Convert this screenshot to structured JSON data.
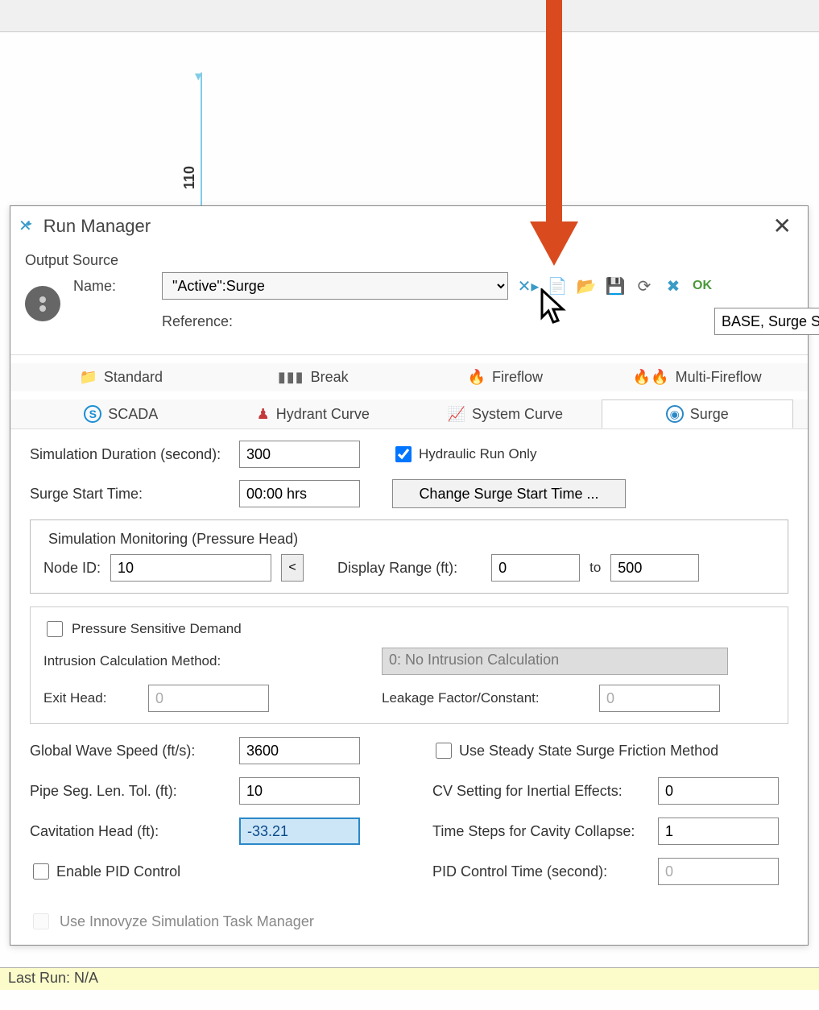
{
  "canvas": {
    "vertical_label": "110"
  },
  "dialog": {
    "title": "Run Manager",
    "output_source": {
      "section_label": "Output Source",
      "name_label": "Name:",
      "name_value": "\"Active\":Surge",
      "reference_label": "Reference:",
      "reference_value": "BASE, Surge Simulation",
      "ok_label": "OK"
    },
    "tabs": {
      "standard": "Standard",
      "break": "Break",
      "fireflow": "Fireflow",
      "multi_fireflow": "Multi-Fireflow",
      "scada": "SCADA",
      "hydrant_curve": "Hydrant Curve",
      "system_curve": "System Curve",
      "surge": "Surge"
    },
    "surge_panel": {
      "sim_duration_label": "Simulation Duration (second):",
      "sim_duration_value": "300",
      "hydraulic_run_only_label": "Hydraulic Run Only",
      "hydraulic_run_only_checked": true,
      "surge_start_time_label": "Surge Start Time:",
      "surge_start_time_value": "00:00 hrs",
      "change_surge_start_button": "Change Surge Start Time ...",
      "monitoring": {
        "legend": "Simulation Monitoring (Pressure Head)",
        "node_id_label": "Node ID:",
        "node_id_value": "10",
        "display_range_label": "Display Range (ft):",
        "range_min": "0",
        "range_to": "to",
        "range_max": "500"
      },
      "psd_section": {
        "psd_label": "Pressure Sensitive Demand",
        "psd_checked": false,
        "intrusion_label": "Intrusion Calculation Method:",
        "intrusion_value": "0: No Intrusion Calculation",
        "exit_head_label": "Exit Head:",
        "exit_head_value": "0",
        "leakage_label": "Leakage Factor/Constant:",
        "leakage_value": "0"
      },
      "global_wave_speed_label": "Global Wave Speed (ft/s):",
      "global_wave_speed_value": "3600",
      "use_steady_state_label": "Use Steady State Surge Friction Method",
      "use_steady_state_checked": false,
      "pipe_seg_label": "Pipe Seg. Len. Tol. (ft):",
      "pipe_seg_value": "10",
      "cv_setting_label": "CV Setting for Inertial Effects:",
      "cv_setting_value": "0",
      "cavitation_head_label": "Cavitation Head (ft):",
      "cavitation_head_value": "-33.21",
      "time_steps_label": "Time Steps for Cavity Collapse:",
      "time_steps_value": "1",
      "enable_pid_label": "Enable PID Control",
      "enable_pid_checked": false,
      "pid_control_time_label": "PID Control Time (second):",
      "pid_control_time_value": "0",
      "task_manager_label": "Use Innovyze Simulation Task Manager",
      "task_manager_checked": false
    }
  },
  "statusbar": {
    "text": "Last Run: N/A"
  }
}
